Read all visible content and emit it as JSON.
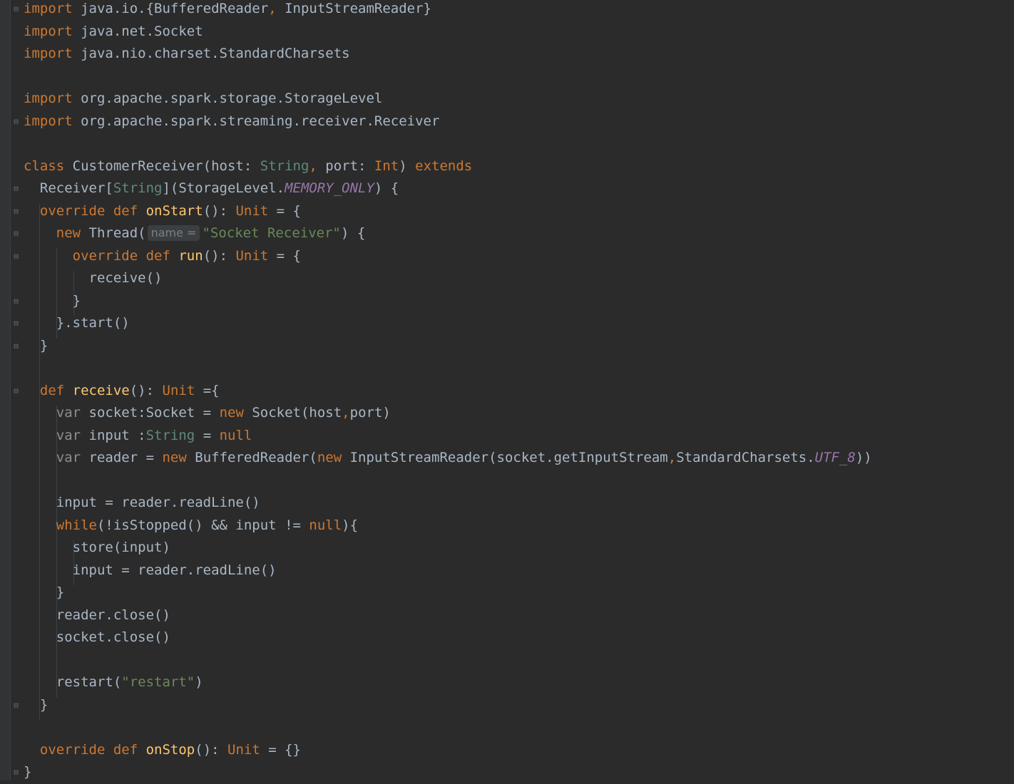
{
  "editor": {
    "lines": [
      [
        {
          "t": "import",
          "c": "kw"
        },
        {
          "t": " java.io.{BufferedReader"
        },
        {
          "t": ",",
          "c": "kw"
        },
        {
          "t": " InputStreamReader}"
        }
      ],
      [
        {
          "t": "import",
          "c": "kw"
        },
        {
          "t": " java.net.Socket"
        }
      ],
      [
        {
          "t": "import",
          "c": "kw"
        },
        {
          "t": " java.nio.charset.StandardCharsets"
        }
      ],
      [],
      [
        {
          "t": "import",
          "c": "kw"
        },
        {
          "t": " org.apache.spark.storage.StorageLevel"
        }
      ],
      [
        {
          "t": "import",
          "c": "kw"
        },
        {
          "t": " org.apache.spark.streaming.receiver.Receiver"
        }
      ],
      [],
      [
        {
          "t": "class ",
          "c": "kw"
        },
        {
          "t": "CustomerReceiver(host: "
        },
        {
          "t": "String",
          "c": "typegreen"
        },
        {
          "t": ",",
          "c": "kw"
        },
        {
          "t": " port: "
        },
        {
          "t": "Int",
          "c": "type"
        },
        {
          "t": ") "
        },
        {
          "t": "extends",
          "c": "kw"
        }
      ],
      [
        {
          "t": "  Receiver["
        },
        {
          "t": "String",
          "c": "typegreen"
        },
        {
          "t": "](StorageLevel."
        },
        {
          "t": "MEMORY_ONLY",
          "c": "const"
        },
        {
          "t": ") {"
        }
      ],
      [
        {
          "t": "  "
        },
        {
          "t": "override def ",
          "c": "kw"
        },
        {
          "t": "onStart",
          "c": "fn"
        },
        {
          "t": "(): "
        },
        {
          "t": "Unit",
          "c": "type"
        },
        {
          "t": " = {"
        }
      ],
      [
        {
          "t": "    "
        },
        {
          "t": "new ",
          "c": "kw"
        },
        {
          "t": "Thread("
        },
        {
          "t": "name =",
          "c": "hint"
        },
        {
          "t": "\"Socket Receiver\"",
          "c": "str"
        },
        {
          "t": ") {"
        }
      ],
      [
        {
          "t": "      "
        },
        {
          "t": "override def ",
          "c": "kw"
        },
        {
          "t": "run",
          "c": "fn"
        },
        {
          "t": "(): "
        },
        {
          "t": "Unit",
          "c": "type"
        },
        {
          "t": " = {"
        }
      ],
      [
        {
          "t": "        receive()"
        }
      ],
      [
        {
          "t": "      }"
        }
      ],
      [
        {
          "t": "    }.start()"
        }
      ],
      [
        {
          "t": "  }"
        }
      ],
      [],
      [
        {
          "t": "  "
        },
        {
          "t": "def ",
          "c": "kw"
        },
        {
          "t": "receive",
          "c": "fn"
        },
        {
          "t": "(): "
        },
        {
          "t": "Unit",
          "c": "type"
        },
        {
          "t": " ={"
        }
      ],
      [
        {
          "t": "    "
        },
        {
          "t": "var",
          "c": "var"
        },
        {
          "t": " socket:Socket = "
        },
        {
          "t": "new ",
          "c": "kw"
        },
        {
          "t": "Socket(host"
        },
        {
          "t": ",",
          "c": "kw"
        },
        {
          "t": "port)"
        }
      ],
      [
        {
          "t": "    "
        },
        {
          "t": "var",
          "c": "var"
        },
        {
          "t": " input :"
        },
        {
          "t": "String",
          "c": "typegreen"
        },
        {
          "t": " = "
        },
        {
          "t": "null",
          "c": "kw"
        }
      ],
      [
        {
          "t": "    "
        },
        {
          "t": "var",
          "c": "var"
        },
        {
          "t": " reader = "
        },
        {
          "t": "new ",
          "c": "kw"
        },
        {
          "t": "BufferedReader("
        },
        {
          "t": "new ",
          "c": "kw"
        },
        {
          "t": "InputStreamReader(socket.getInputStream"
        },
        {
          "t": ",",
          "c": "kw"
        },
        {
          "t": "StandardCharsets."
        },
        {
          "t": "UTF_8",
          "c": "const"
        },
        {
          "t": "))"
        }
      ],
      [],
      [
        {
          "t": "    input = reader.readLine()"
        }
      ],
      [
        {
          "t": "    "
        },
        {
          "t": "while",
          "c": "kw"
        },
        {
          "t": "(!isStopped() && input != "
        },
        {
          "t": "null",
          "c": "kw"
        },
        {
          "t": "){"
        }
      ],
      [
        {
          "t": "      store(input)"
        }
      ],
      [
        {
          "t": "      input = reader.readLine()"
        }
      ],
      [
        {
          "t": "    }"
        }
      ],
      [
        {
          "t": "    reader.close()"
        }
      ],
      [
        {
          "t": "    socket.close()"
        }
      ],
      [],
      [
        {
          "t": "    restart("
        },
        {
          "t": "\"restart\"",
          "c": "str"
        },
        {
          "t": ")"
        }
      ],
      [
        {
          "t": "  }"
        }
      ],
      [],
      [
        {
          "t": "  "
        },
        {
          "t": "override def ",
          "c": "kw"
        },
        {
          "t": "onStop",
          "c": "fn"
        },
        {
          "t": "(): "
        },
        {
          "t": "Unit",
          "c": "type"
        },
        {
          "t": " = {}"
        }
      ],
      [
        {
          "t": "}"
        }
      ]
    ]
  }
}
